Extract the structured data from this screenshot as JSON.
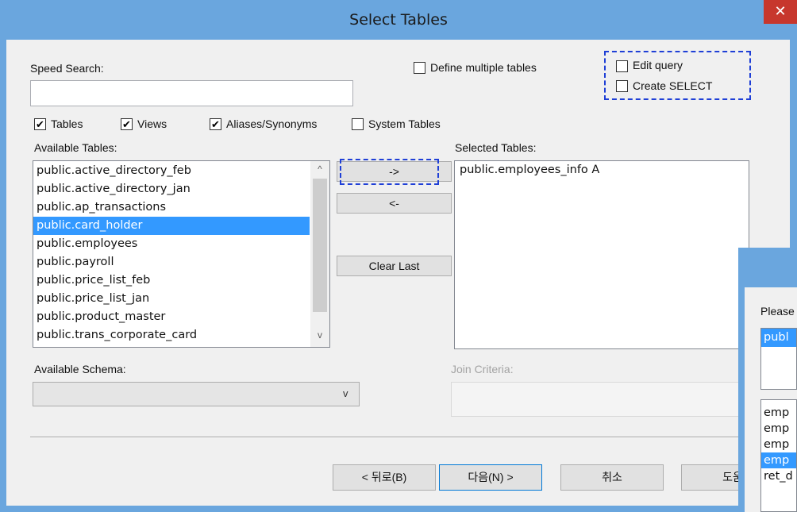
{
  "window": {
    "title": "Select Tables",
    "close_glyph": "✕"
  },
  "speed_search": {
    "label": "Speed Search:",
    "value": ""
  },
  "options": {
    "define_multiple": {
      "label": "Define multiple tables",
      "checked": false
    },
    "edit_query": {
      "label": "Edit query",
      "checked": false
    },
    "create_select": {
      "label": "Create SELECT",
      "checked": false
    }
  },
  "filters": [
    {
      "label": "Tables",
      "checked": true
    },
    {
      "label": "Views",
      "checked": true
    },
    {
      "label": "Aliases/Synonyms",
      "checked": true
    },
    {
      "label": "System Tables",
      "checked": false
    }
  ],
  "check_glyph": "✔",
  "available": {
    "label": "Available Tables:",
    "items": [
      "public.active_directory_feb",
      "public.active_directory_jan",
      "public.ap_transactions",
      "public.card_holder",
      "public.employees",
      "public.payroll",
      "public.price_list_feb",
      "public.price_list_jan",
      "public.product_master",
      "public.trans_corporate_card"
    ],
    "selected_index": 3,
    "scroll_up": "^",
    "scroll_down": "v"
  },
  "buttons": {
    "add": "->",
    "remove": "<-",
    "clear_last": "Clear Last"
  },
  "selected": {
    "label": "Selected Tables:",
    "items": [
      "public.employees_info A"
    ]
  },
  "schema": {
    "label": "Available Schema:",
    "value": "",
    "arrow": "v"
  },
  "join": {
    "label": "Join Criteria:",
    "value": ""
  },
  "footer": {
    "back": "< 뒤로(B)",
    "next": "다음(N) >",
    "cancel": "취소",
    "help": "도움"
  },
  "dialog2": {
    "prompt": "Please",
    "top_item": "publ",
    "items": [
      "emp",
      "emp",
      "emp",
      "emp",
      "ret_d"
    ],
    "selected_index": 3
  },
  "colors": {
    "titlebar": "#6aa6de",
    "selection": "#3399ff",
    "focus_dash": "#1f3fd6",
    "close": "#c7372d"
  }
}
